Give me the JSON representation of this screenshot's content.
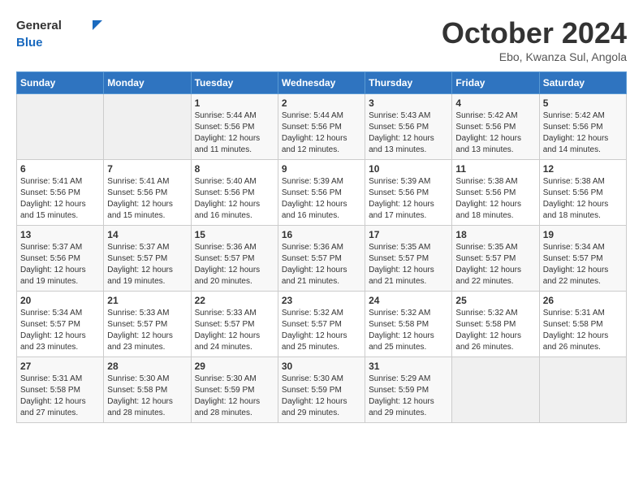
{
  "header": {
    "logo_general": "General",
    "logo_blue": "Blue",
    "month_title": "October 2024",
    "location": "Ebo, Kwanza Sul, Angola"
  },
  "columns": [
    "Sunday",
    "Monday",
    "Tuesday",
    "Wednesday",
    "Thursday",
    "Friday",
    "Saturday"
  ],
  "weeks": [
    [
      {
        "day": "",
        "info": ""
      },
      {
        "day": "",
        "info": ""
      },
      {
        "day": "1",
        "info": "Sunrise: 5:44 AM\nSunset: 5:56 PM\nDaylight: 12 hours and 11 minutes."
      },
      {
        "day": "2",
        "info": "Sunrise: 5:44 AM\nSunset: 5:56 PM\nDaylight: 12 hours and 12 minutes."
      },
      {
        "day": "3",
        "info": "Sunrise: 5:43 AM\nSunset: 5:56 PM\nDaylight: 12 hours and 13 minutes."
      },
      {
        "day": "4",
        "info": "Sunrise: 5:42 AM\nSunset: 5:56 PM\nDaylight: 12 hours and 13 minutes."
      },
      {
        "day": "5",
        "info": "Sunrise: 5:42 AM\nSunset: 5:56 PM\nDaylight: 12 hours and 14 minutes."
      }
    ],
    [
      {
        "day": "6",
        "info": "Sunrise: 5:41 AM\nSunset: 5:56 PM\nDaylight: 12 hours and 15 minutes."
      },
      {
        "day": "7",
        "info": "Sunrise: 5:41 AM\nSunset: 5:56 PM\nDaylight: 12 hours and 15 minutes."
      },
      {
        "day": "8",
        "info": "Sunrise: 5:40 AM\nSunset: 5:56 PM\nDaylight: 12 hours and 16 minutes."
      },
      {
        "day": "9",
        "info": "Sunrise: 5:39 AM\nSunset: 5:56 PM\nDaylight: 12 hours and 16 minutes."
      },
      {
        "day": "10",
        "info": "Sunrise: 5:39 AM\nSunset: 5:56 PM\nDaylight: 12 hours and 17 minutes."
      },
      {
        "day": "11",
        "info": "Sunrise: 5:38 AM\nSunset: 5:56 PM\nDaylight: 12 hours and 18 minutes."
      },
      {
        "day": "12",
        "info": "Sunrise: 5:38 AM\nSunset: 5:56 PM\nDaylight: 12 hours and 18 minutes."
      }
    ],
    [
      {
        "day": "13",
        "info": "Sunrise: 5:37 AM\nSunset: 5:56 PM\nDaylight: 12 hours and 19 minutes."
      },
      {
        "day": "14",
        "info": "Sunrise: 5:37 AM\nSunset: 5:57 PM\nDaylight: 12 hours and 19 minutes."
      },
      {
        "day": "15",
        "info": "Sunrise: 5:36 AM\nSunset: 5:57 PM\nDaylight: 12 hours and 20 minutes."
      },
      {
        "day": "16",
        "info": "Sunrise: 5:36 AM\nSunset: 5:57 PM\nDaylight: 12 hours and 21 minutes."
      },
      {
        "day": "17",
        "info": "Sunrise: 5:35 AM\nSunset: 5:57 PM\nDaylight: 12 hours and 21 minutes."
      },
      {
        "day": "18",
        "info": "Sunrise: 5:35 AM\nSunset: 5:57 PM\nDaylight: 12 hours and 22 minutes."
      },
      {
        "day": "19",
        "info": "Sunrise: 5:34 AM\nSunset: 5:57 PM\nDaylight: 12 hours and 22 minutes."
      }
    ],
    [
      {
        "day": "20",
        "info": "Sunrise: 5:34 AM\nSunset: 5:57 PM\nDaylight: 12 hours and 23 minutes."
      },
      {
        "day": "21",
        "info": "Sunrise: 5:33 AM\nSunset: 5:57 PM\nDaylight: 12 hours and 23 minutes."
      },
      {
        "day": "22",
        "info": "Sunrise: 5:33 AM\nSunset: 5:57 PM\nDaylight: 12 hours and 24 minutes."
      },
      {
        "day": "23",
        "info": "Sunrise: 5:32 AM\nSunset: 5:57 PM\nDaylight: 12 hours and 25 minutes."
      },
      {
        "day": "24",
        "info": "Sunrise: 5:32 AM\nSunset: 5:58 PM\nDaylight: 12 hours and 25 minutes."
      },
      {
        "day": "25",
        "info": "Sunrise: 5:32 AM\nSunset: 5:58 PM\nDaylight: 12 hours and 26 minutes."
      },
      {
        "day": "26",
        "info": "Sunrise: 5:31 AM\nSunset: 5:58 PM\nDaylight: 12 hours and 26 minutes."
      }
    ],
    [
      {
        "day": "27",
        "info": "Sunrise: 5:31 AM\nSunset: 5:58 PM\nDaylight: 12 hours and 27 minutes."
      },
      {
        "day": "28",
        "info": "Sunrise: 5:30 AM\nSunset: 5:58 PM\nDaylight: 12 hours and 28 minutes."
      },
      {
        "day": "29",
        "info": "Sunrise: 5:30 AM\nSunset: 5:59 PM\nDaylight: 12 hours and 28 minutes."
      },
      {
        "day": "30",
        "info": "Sunrise: 5:30 AM\nSunset: 5:59 PM\nDaylight: 12 hours and 29 minutes."
      },
      {
        "day": "31",
        "info": "Sunrise: 5:29 AM\nSunset: 5:59 PM\nDaylight: 12 hours and 29 minutes."
      },
      {
        "day": "",
        "info": ""
      },
      {
        "day": "",
        "info": ""
      }
    ]
  ]
}
